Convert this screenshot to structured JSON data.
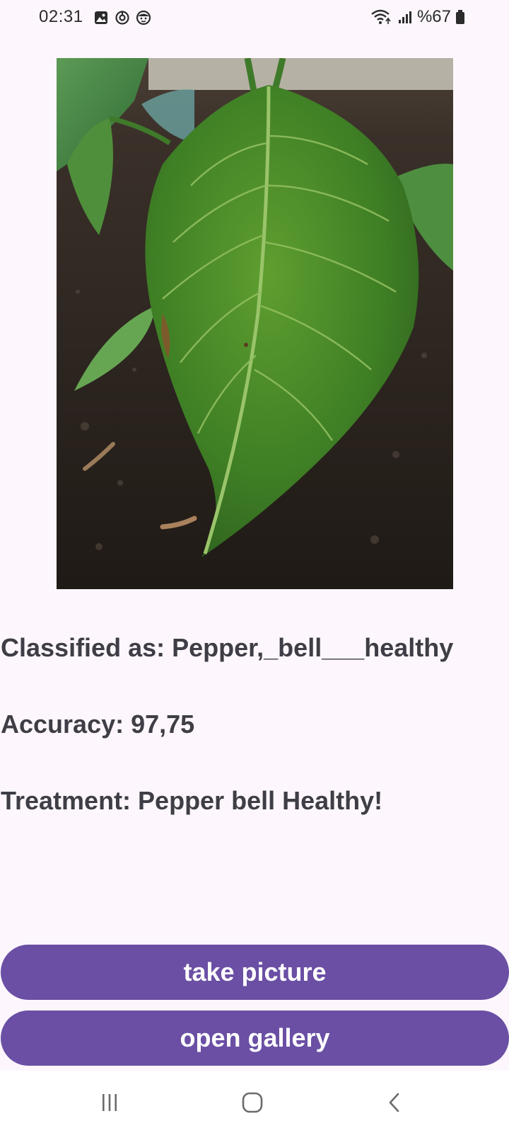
{
  "status_bar": {
    "time": "02:31",
    "battery": "%67",
    "icons": [
      "gallery-icon",
      "sync-icon",
      "face-icon",
      "wifi-icon",
      "signal-icon",
      "battery-icon"
    ]
  },
  "photo": {
    "subject": "plant-leaf-image"
  },
  "result": {
    "classified": "Classified as: Pepper,_bell___healthy",
    "accuracy": "Accuracy: 97,75",
    "treatment": "Treatment: Pepper bell Healthy!"
  },
  "buttons": {
    "take_picture": "take picture",
    "open_gallery": "open gallery"
  },
  "nav": {
    "icons": [
      "recents-icon",
      "home-icon",
      "back-icon"
    ]
  },
  "colors": {
    "background": "#fdf7fd",
    "button": "#6a4fa4",
    "text": "#3f3d45"
  }
}
